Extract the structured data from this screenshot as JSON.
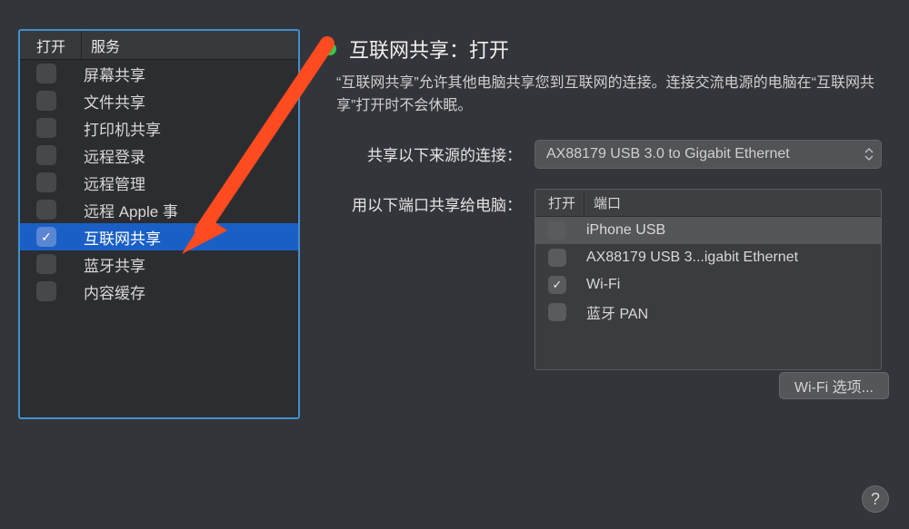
{
  "sidebar": {
    "header_on": "打开",
    "header_service": "服务",
    "items": [
      {
        "label": "屏幕共享",
        "checked": false,
        "selected": false
      },
      {
        "label": "文件共享",
        "checked": false,
        "selected": false
      },
      {
        "label": "打印机共享",
        "checked": false,
        "selected": false
      },
      {
        "label": "远程登录",
        "checked": false,
        "selected": false
      },
      {
        "label": "远程管理",
        "checked": false,
        "selected": false
      },
      {
        "label": "远程 Apple 事",
        "checked": false,
        "selected": false
      },
      {
        "label": "互联网共享",
        "checked": true,
        "selected": true
      },
      {
        "label": "蓝牙共享",
        "checked": false,
        "selected": false
      },
      {
        "label": "内容缓存",
        "checked": false,
        "selected": false
      }
    ]
  },
  "detail": {
    "status_color": "#36c84b",
    "title": "互联网共享：打开",
    "description": "“互联网共享”允许其他电脑共享您到互联网的连接。连接交流电源的电脑在“互联网共享”打开时不会休眠。",
    "source_label": "共享以下来源的连接：",
    "source_value": "AX88179 USB 3.0 to Gigabit Ethernet",
    "ports_label": "用以下端口共享给电脑：",
    "ports_header_on": "打开",
    "ports_header_port": "端口",
    "ports": [
      {
        "label": "iPhone USB",
        "checked": false,
        "selected": true
      },
      {
        "label": "AX88179 USB 3...igabit Ethernet",
        "checked": false,
        "selected": false
      },
      {
        "label": "Wi-Fi",
        "checked": true,
        "selected": false
      },
      {
        "label": "蓝牙 PAN",
        "checked": false,
        "selected": false
      }
    ],
    "wifi_options_button": "Wi-Fi 选项...",
    "help_glyph": "?"
  },
  "annotation": {
    "arrow_color": "#ff4b1f"
  }
}
